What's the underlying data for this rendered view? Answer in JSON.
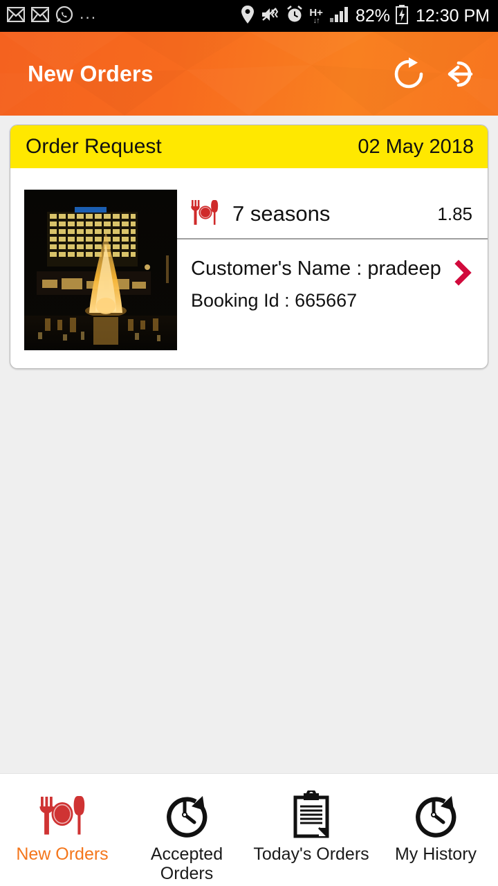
{
  "status_bar": {
    "notification_icons": [
      "gmail-icon",
      "gmail-icon",
      "whatsapp-icon"
    ],
    "overflow": "...",
    "location_icon": "location-pin-icon",
    "sound_icon": "vibrate-mute-icon",
    "alarm_icon": "alarm-clock-icon",
    "network_type": "H+",
    "data_arrows": "↓↑",
    "signal_icon": "signal-bars-icon",
    "battery_percent": "82%",
    "battery_icon": "battery-charging-icon",
    "time": "12:30 PM"
  },
  "app_bar": {
    "title": "New Orders",
    "refresh_label": "refresh",
    "logout_label": "logout",
    "background_color": "#f4661f"
  },
  "order_card": {
    "header": {
      "title": "Order Request",
      "date": "02 May 2018",
      "background_color": "#ffe800"
    },
    "thumbnail_alt": "restaurant-night-photo",
    "restaurant": {
      "icon": "restaurant-cutlery-icon",
      "name": "7 seasons",
      "rating": "1.85"
    },
    "customer": {
      "name_line": "Customer's Name : pradeep",
      "booking_line": "Booking Id : 665667",
      "chevron": "chevron-right-icon",
      "chevron_color": "#d10a3c"
    }
  },
  "bottom_nav": {
    "active_color": "#f4761b",
    "items": [
      {
        "label": "New Orders",
        "icon": "restaurant-cutlery-icon",
        "active": true
      },
      {
        "label": "Accepted Orders",
        "icon": "clock-arrow-icon",
        "active": false
      },
      {
        "label": "Today's Orders",
        "icon": "clipboard-icon",
        "active": false
      },
      {
        "label": "My History",
        "icon": "clock-arrow-icon",
        "active": false
      }
    ]
  }
}
